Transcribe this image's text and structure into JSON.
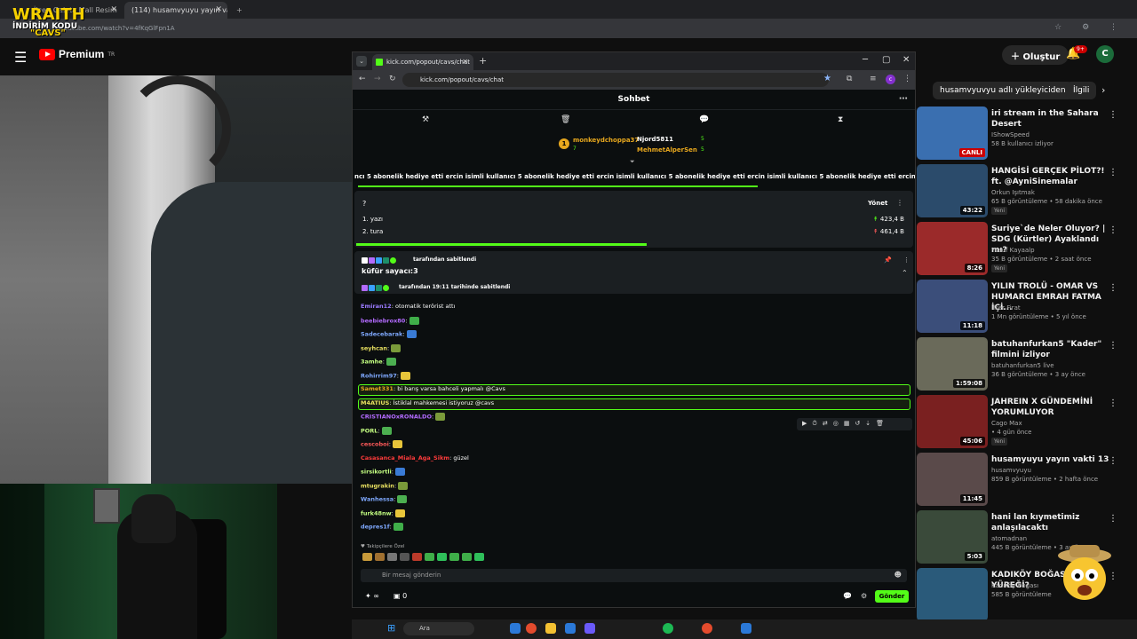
{
  "browser": {
    "tabs": [
      {
        "label": "İlçe - Galata Mall Resim"
      },
      {
        "label": "(114) husamvyuyu yayın vakti 14"
      }
    ],
    "url": "youtube.com/watch?v=4fKqGlFpn1A"
  },
  "overlay": {
    "logo": "WRAITH",
    "line1": "İNDİRİM KODU",
    "line2": "\"CAVS\""
  },
  "youtube": {
    "logo": "Premium",
    "region": "TR",
    "create": "Oluştur",
    "notif_count": "9+",
    "avatar": "C",
    "chips": [
      "husamvyuvyu adlı yükleyiciden",
      "İlgili"
    ]
  },
  "recs": [
    {
      "title": "iri stream in the Sahara  Desert",
      "channel": "IShowSpeed",
      "meta": "58 B kullanıcı izliyor",
      "badge": "CANLI",
      "new": ""
    },
    {
      "title": "HANGİSİ GERÇEK PİLOT?! ft. @AyniSinemalar",
      "channel": "Orkun Işıtmak",
      "meta": "65 B görüntüleme • 58 dakika önce",
      "badge": "43:22",
      "new": "Yeni"
    },
    {
      "title": "Suriye`de Neler Oluyor? | SDG (Kürtler) Ayaklandı mı?",
      "channel": "Yusuf Kayaalp",
      "meta": "35 B görüntüleme • 2 saat önce",
      "badge": "8:26",
      "new": "Yeni"
    },
    {
      "title": "YILIN TROLÜ - OMAR VS HUMARCI EMRAH FATMA İÇİ...",
      "channel": "İlker Firat",
      "meta": "1 Mn görüntüleme • 5 yıl önce",
      "badge": "11:18",
      "new": ""
    },
    {
      "title": "batuhanfurkan5 \"Kader\" filmini izliyor",
      "channel": "batuhanfurkan5 live",
      "meta": "36 B görüntüleme • 3 ay önce",
      "badge": "1:59:08",
      "new": ""
    },
    {
      "title": "JAHREIN X GÜNDEMİNİ YORUMLUYOR",
      "channel": "Cago Max",
      "meta": "",
      "badge": "45:06",
      "new": "Yeni",
      "meta2": "• 4 gün önce"
    },
    {
      "title": "husamyuyu yayın vakti 13",
      "channel": "husamvyuyu",
      "meta": "859 B görüntüleme • 2 hafta önce",
      "badge": "11:45",
      "new": ""
    },
    {
      "title": "hani lan kıymetimiz anlaşılacaktı",
      "channel": "atomadnan",
      "meta": "445 B görüntüleme • 3 ay önce",
      "badge": "5:03",
      "new": ""
    },
    {
      "title": "KADIKÖY BOĞASI A YÜREĞİ?",
      "channel": "Kadıköy Boğası",
      "meta": "585 B görüntüleme",
      "badge": "",
      "new": ""
    }
  ],
  "popup": {
    "tab_label": "kick.com/popout/cavs/chat",
    "url": "kick.com/popout/cavs/chat",
    "header": "Sohbet",
    "leaders": [
      {
        "rank": "1",
        "name": "monkeydchoppa37",
        "count": "7"
      },
      {
        "name": "Njord5811",
        "count": "5"
      },
      {
        "name": "MehmetAlperSen",
        "count": "5"
      }
    ],
    "ticker": "ncı 5 abonelik hediye etti   ercin isimli kullanıcı 5 abonelik hediye etti   ercin isimli kullanıcı 5 abonelik hediye etti   ercin isimli kullanıcı 5 abonelik hediye etti   ercin isimli kulla",
    "poll": {
      "question": "?",
      "manage": "Yönet",
      "options": [
        {
          "label": "1. yazı",
          "value": "423,4 B"
        },
        {
          "label": "2. tura",
          "value": "461,4 B"
        }
      ],
      "progress": 0.52
    },
    "pinned": {
      "byline": "tarafından sabitlendi",
      "message": "küfür sayacı:3",
      "sub": "tarafından 19:11 tarihinde sabitlendi"
    },
    "messages": [
      {
        "user": "Emiran12",
        "text": ": otomatik terörist attı",
        "color": "#9b7bff"
      },
      {
        "user": "beebiebrox80",
        "text": ":",
        "color": "#b36bff"
      },
      {
        "user": "Sadecebarak",
        "text": ":",
        "color": "#7fa9ff"
      },
      {
        "user": "seyhcan",
        "text": ":",
        "color": "#e8e060"
      },
      {
        "user": "3amhe",
        "text": ":",
        "color": "#c4ff82"
      },
      {
        "user": "Rohirrim97",
        "text": ":",
        "color": "#7fa9ff"
      },
      {
        "user": "Samet331",
        "text": ": bi barış varsa bahceli yapmalı @Cavs",
        "color": "#e8a81e"
      },
      {
        "user": "M4ATIUS",
        "text": ": İstiklal mahkemesi istiyoruz @cavs",
        "color": "#e8e060"
      },
      {
        "user": "CRISTIANOxRONALDO",
        "text": ":",
        "color": "#b36bff"
      },
      {
        "user": "PORL",
        "text": ":",
        "color": "#c4ff82"
      },
      {
        "user": "cescoboi",
        "text": ":",
        "color": "#ff5a5a"
      },
      {
        "user": "Casasanca_Miala_Aga_Sikm",
        "text": ": güzel",
        "color": "#ff3b3b"
      },
      {
        "user": "sirsikortli",
        "text": ":",
        "color": "#c4ff82"
      },
      {
        "user": "mtugrakin",
        "text": ":",
        "color": "#e8e060"
      },
      {
        "user": "Wanhessa",
        "text": ":",
        "color": "#7fa9ff"
      },
      {
        "user": "furk48nw",
        "text": ":",
        "color": "#c4ff82"
      },
      {
        "user": "depres1f",
        "text": ":",
        "color": "#7fa9ff"
      }
    ],
    "emote_label": "Takipçilere Özel",
    "input_placeholder": "Bir mesaj gönderin",
    "points": "∞",
    "count": "0",
    "send": "Gönder"
  },
  "taskbar": {
    "search": "Ara"
  },
  "colors": {
    "kick_green": "#53fc18",
    "yt_red": "#ff0000"
  }
}
